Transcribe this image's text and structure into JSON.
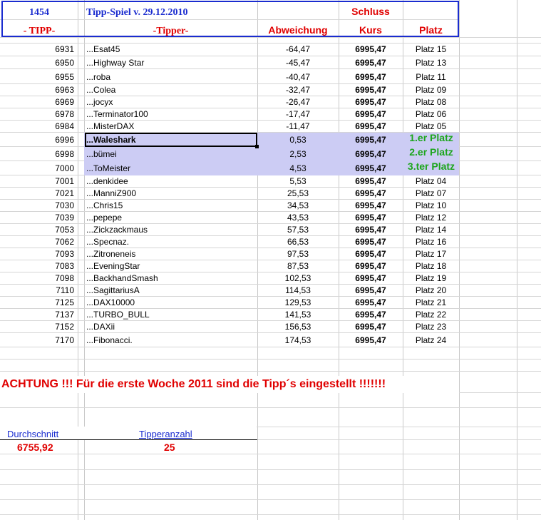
{
  "colors": {
    "header_blue": "#1a2ccf",
    "header_red": "#e00000",
    "green_rank": "#1ca51c",
    "highlight": "#ccccf4"
  },
  "header": {
    "id_number": "1454",
    "title": "Tipp-Spiel v. 29.12.2010",
    "schluss": "Schluss",
    "col_tipp": "- TIPP-",
    "col_tipper": "-Tipper-",
    "col_abweichung": "Abweichung",
    "col_kurs": "Kurs",
    "col_platz": "Platz"
  },
  "rows": [
    {
      "tipp": "6931",
      "name": "...Esat45",
      "abw": "-64,47",
      "kurs": "6995,47",
      "platz": "Platz 15"
    },
    {
      "tipp": "6950",
      "name": "...Highway Star",
      "abw": "-45,47",
      "kurs": "6995,47",
      "platz": "Platz 13"
    },
    {
      "tipp": "6955",
      "name": "...roba",
      "abw": "-40,47",
      "kurs": "6995,47",
      "platz": "Platz 11"
    },
    {
      "tipp": "6963",
      "name": "...Colea",
      "abw": "-32,47",
      "kurs": "6995,47",
      "platz": "Platz 09"
    },
    {
      "tipp": "6969",
      "name": "...jocyx",
      "abw": "-26,47",
      "kurs": "6995,47",
      "platz": "Platz 08"
    },
    {
      "tipp": "6978",
      "name": "...Terminator100",
      "abw": "-17,47",
      "kurs": "6995,47",
      "platz": "Platz 06"
    },
    {
      "tipp": "6984",
      "name": "...MisterDAX",
      "abw": "-11,47",
      "kurs": "6995,47",
      "platz": "Platz 05"
    },
    {
      "tipp": "6996",
      "name": "...Waleshark",
      "abw": "0,53",
      "kurs": "6995,47",
      "platz": "1.er Platz"
    },
    {
      "tipp": "6998",
      "name": "...bümei",
      "abw": "2,53",
      "kurs": "6995,47",
      "platz": "2.er Platz"
    },
    {
      "tipp": "7000",
      "name": "...ToMeister",
      "abw": "4,53",
      "kurs": "6995,47",
      "platz": "3.ter Platz"
    },
    {
      "tipp": "7001",
      "name": "...denkidee",
      "abw": "5,53",
      "kurs": "6995,47",
      "platz": "Platz 04"
    },
    {
      "tipp": "7021",
      "name": "...ManniZ900",
      "abw": "25,53",
      "kurs": "6995,47",
      "platz": "Platz 07"
    },
    {
      "tipp": "7030",
      "name": "...Chris15",
      "abw": "34,53",
      "kurs": "6995,47",
      "platz": "Platz 10"
    },
    {
      "tipp": "7039",
      "name": "...pepepe",
      "abw": "43,53",
      "kurs": "6995,47",
      "platz": "Platz 12"
    },
    {
      "tipp": "7053",
      "name": "...Zickzackmaus",
      "abw": "57,53",
      "kurs": "6995,47",
      "platz": "Platz 14"
    },
    {
      "tipp": "7062",
      "name": "...Specnaz.",
      "abw": "66,53",
      "kurs": "6995,47",
      "platz": "Platz 16"
    },
    {
      "tipp": "7093",
      "name": "...Zitroneneis",
      "abw": "97,53",
      "kurs": "6995,47",
      "platz": "Platz 17"
    },
    {
      "tipp": "7083",
      "name": "...EveningStar",
      "abw": "87,53",
      "kurs": "6995,47",
      "platz": "Platz 18"
    },
    {
      "tipp": "7098",
      "name": "...BackhandSmash",
      "abw": "102,53",
      "kurs": "6995,47",
      "platz": "Platz 19"
    },
    {
      "tipp": "7110",
      "name": "...SagittariusA",
      "abw": "114,53",
      "kurs": "6995,47",
      "platz": "Platz 20"
    },
    {
      "tipp": "7125",
      "name": "...DAX10000",
      "abw": "129,53",
      "kurs": "6995,47",
      "platz": "Platz 21"
    },
    {
      "tipp": "7137",
      "name": "...TURBO_BULL",
      "abw": "141,53",
      "kurs": "6995,47",
      "platz": "Platz 22"
    },
    {
      "tipp": "7152",
      "name": "...DAXii",
      "abw": "156,53",
      "kurs": "6995,47",
      "platz": "Platz 23"
    },
    {
      "tipp": "7170",
      "name": "...Fibonacci.",
      "abw": "174,53",
      "kurs": "6995,47",
      "platz": "Platz 24"
    }
  ],
  "notice": "ACHTUNG !!!  Für die erste Woche 2011 sind die Tipp´s eingestellt !!!!!!!",
  "summary": {
    "durchschnitt_label": "Durchschnitt",
    "durchschnitt_value": "6755,92",
    "tipperanzahl_label": "Tipperanzahl",
    "tipperanzahl_value": "25"
  }
}
